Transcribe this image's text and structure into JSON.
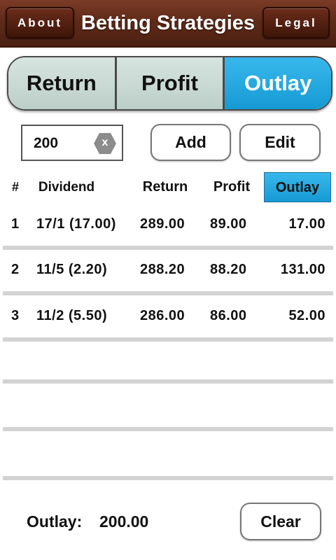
{
  "header": {
    "title": "Betting Strategies",
    "about_label": "About",
    "legal_label": "Legal"
  },
  "modes": [
    {
      "label": "Return",
      "active": false
    },
    {
      "label": "Profit",
      "active": false
    },
    {
      "label": "Outlay",
      "active": true
    }
  ],
  "input": {
    "value": "200",
    "clear_glyph": "x"
  },
  "buttons": {
    "add_label": "Add",
    "edit_label": "Edit",
    "clear_label": "Clear"
  },
  "table": {
    "columns": [
      "#",
      "Dividend",
      "Return",
      "Profit",
      "Outlay"
    ],
    "highlighted_column": "Outlay",
    "rows": [
      {
        "num": "1",
        "dividend": "17/1 (17.00)",
        "return": "289.00",
        "profit": "89.00",
        "outlay": "17.00"
      },
      {
        "num": "2",
        "dividend": "11/5 (2.20)",
        "return": "288.20",
        "profit": "88.20",
        "outlay": "131.00"
      },
      {
        "num": "3",
        "dividend": "11/2 (5.50)",
        "return": "286.00",
        "profit": "86.00",
        "outlay": "52.00"
      },
      {
        "num": "",
        "dividend": "",
        "return": "",
        "profit": "",
        "outlay": ""
      },
      {
        "num": "",
        "dividend": "",
        "return": "",
        "profit": "",
        "outlay": ""
      },
      {
        "num": "",
        "dividend": "",
        "return": "",
        "profit": "",
        "outlay": ""
      }
    ]
  },
  "footer": {
    "label": "Outlay:",
    "value": "200.00"
  },
  "colors": {
    "header_brown": "#5f2b19",
    "accent_blue": "#169ad4",
    "segment_grey_green": "#c6d7d1",
    "separator_grey": "#d3d3d3"
  }
}
